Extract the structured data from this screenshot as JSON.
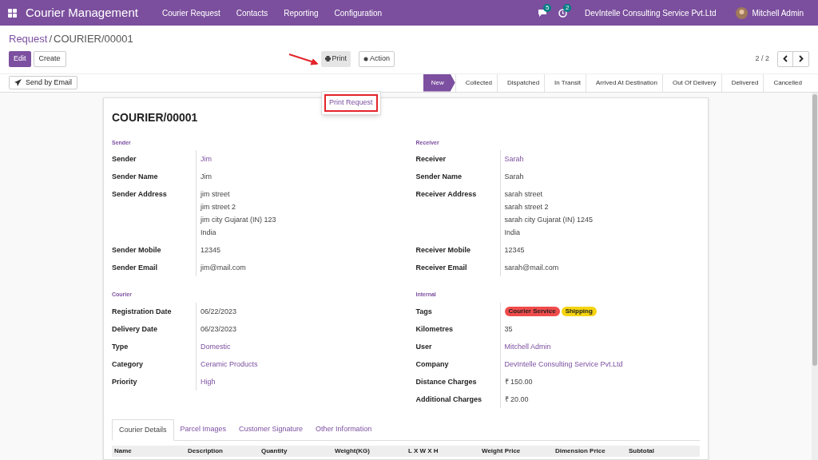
{
  "navbar": {
    "app_title": "Courier Management",
    "menu": [
      "Courier Request",
      "Contacts",
      "Reporting",
      "Configuration"
    ],
    "messages_count": "5",
    "activities_count": "2",
    "company": "DevIntelle Consulting Service Pvt.Ltd",
    "user": "Mitchell Admin"
  },
  "breadcrumb": {
    "parent": "Request",
    "separator": "/",
    "current": "COURIER/00001"
  },
  "buttons": {
    "edit": "Edit",
    "create": "Create",
    "print": "Print",
    "action": "Action",
    "send_email": "Send by Email"
  },
  "print_menu": {
    "expanded": true,
    "items": [
      "Print Request"
    ]
  },
  "pager": "2 / 2",
  "status_steps": [
    {
      "label": "New",
      "selected": true
    },
    {
      "label": "Collected",
      "selected": false
    },
    {
      "label": "Dispatched",
      "selected": false
    },
    {
      "label": "In Transit",
      "selected": false
    },
    {
      "label": "Arrived At Destination",
      "selected": false
    },
    {
      "label": "Out Of Delivery",
      "selected": false
    },
    {
      "label": "Delivered",
      "selected": false
    },
    {
      "label": "Cancelled",
      "selected": false
    }
  ],
  "record_title": "COURIER/00001",
  "groups": [
    {
      "title": "Sender",
      "fields": [
        {
          "label": "Sender",
          "values": [
            "Jim"
          ],
          "link": true
        },
        {
          "label": "Sender Name",
          "values": [
            "Jim"
          ],
          "link": false
        },
        {
          "label": "Sender Address",
          "values": [
            "jim street",
            "jim street 2",
            "jim city  Gujarat (IN)  123",
            "India"
          ],
          "link": false
        },
        {
          "label": "Sender Mobile",
          "values": [
            "12345"
          ],
          "link": false
        },
        {
          "label": "Sender Email",
          "values": [
            "jim@mail.com"
          ],
          "link": false
        }
      ]
    },
    {
      "title": "Receiver",
      "fields": [
        {
          "label": "Receiver",
          "values": [
            "Sarah"
          ],
          "link": true
        },
        {
          "label": "Sender Name",
          "values": [
            "Sarah"
          ],
          "link": false
        },
        {
          "label": "Receiver Address",
          "values": [
            "sarah street",
            "sarah street 2",
            "sarah city  Gujarat (IN)  1245",
            "India"
          ],
          "link": false
        },
        {
          "label": "Receiver Mobile",
          "values": [
            "12345"
          ],
          "link": false
        },
        {
          "label": "Receiver Email",
          "values": [
            "sarah@mail.com"
          ],
          "link": false
        }
      ]
    },
    {
      "title": "Courier",
      "fields": [
        {
          "label": "Registration Date",
          "values": [
            "06/22/2023"
          ],
          "link": false
        },
        {
          "label": "Delivery Date",
          "values": [
            "06/23/2023"
          ],
          "link": false
        },
        {
          "label": "Type",
          "values": [
            "Domestic"
          ],
          "link": true
        },
        {
          "label": "Category",
          "values": [
            "Ceramic Products"
          ],
          "link": true
        },
        {
          "label": "Priority",
          "values": [
            "High"
          ],
          "link": true
        }
      ]
    },
    {
      "title": "Internal",
      "fields": [
        {
          "label": "Tags",
          "tags": [
            {
              "text": "Courier Service",
              "color": "#f04b4b"
            },
            {
              "text": "Shipping",
              "color": "#f5d40f"
            }
          ]
        },
        {
          "label": "Kilometres",
          "values": [
            "35"
          ],
          "link": false
        },
        {
          "label": "User",
          "values": [
            "Mitchell Admin"
          ],
          "link": true
        },
        {
          "label": "Company",
          "values": [
            "DevIntelle Consulting Service Pvt.Ltd"
          ],
          "link": true
        },
        {
          "label": "Distance Charges",
          "values": [
            "₹ 150.00"
          ],
          "link": false
        },
        {
          "label": "Additional Charges",
          "values": [
            "₹ 20.00"
          ],
          "link": false
        }
      ]
    }
  ],
  "notebook_tabs": [
    {
      "label": "Courier Details",
      "selected": true
    },
    {
      "label": "Parcel Images",
      "selected": false
    },
    {
      "label": "Customer Signature",
      "selected": false
    },
    {
      "label": "Other Information",
      "selected": false
    }
  ],
  "table": {
    "columns": [
      "Name",
      "Description",
      "Quantity",
      "Weight(KG)",
      "L X W X H",
      "Weight Price",
      "Dimension Price",
      "Subtotal"
    ]
  }
}
